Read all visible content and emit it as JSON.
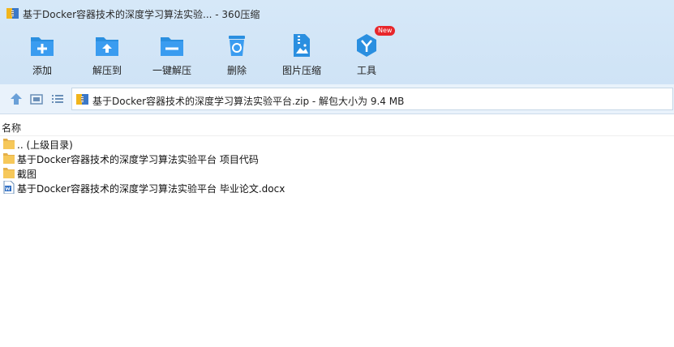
{
  "window": {
    "title": "基于Docker容器技术的深度学习算法实验... - 360压缩"
  },
  "toolbar": {
    "items": [
      {
        "label": "添加",
        "icon": "add-icon"
      },
      {
        "label": "解压到",
        "icon": "extract-to-icon"
      },
      {
        "label": "一键解压",
        "icon": "one-click-extract-icon"
      },
      {
        "label": "删除",
        "icon": "delete-icon"
      },
      {
        "label": "图片压缩",
        "icon": "image-compress-icon"
      },
      {
        "label": "工具",
        "icon": "tools-icon",
        "badge": "New"
      }
    ]
  },
  "address": {
    "path": "基于Docker容器技术的深度学习算法实验平台.zip - 解包大小为 9.4 MB"
  },
  "list": {
    "column_name": "名称",
    "files": [
      {
        "name": ".. (上级目录)",
        "type": "folder"
      },
      {
        "name": "基于Docker容器技术的深度学习算法实验平台 项目代码",
        "type": "folder"
      },
      {
        "name": "截图",
        "type": "folder"
      },
      {
        "name": "基于Docker容器技术的深度学习算法实验平台 毕业论文.docx",
        "type": "docx"
      }
    ]
  },
  "colors": {
    "toolbar_icon_blue": "#2a8fe0",
    "badge_red": "#e8262b",
    "folder_yellow": "#f6c85a"
  }
}
